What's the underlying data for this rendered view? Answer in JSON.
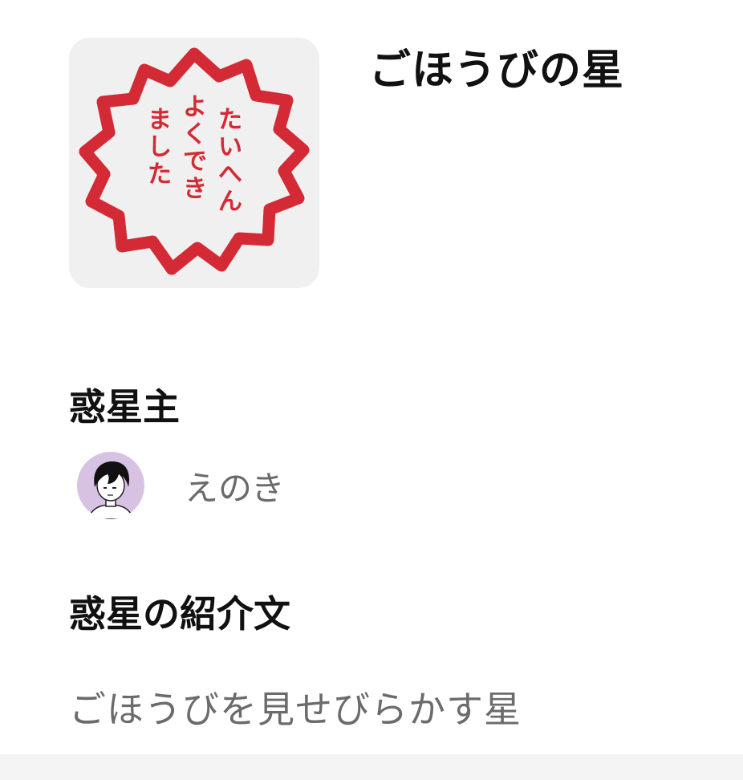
{
  "planet": {
    "name": "ごほうびの星",
    "icon_name": "praise-stamp-icon",
    "stamp_lines": [
      "たいへん",
      "よくでき",
      "ました"
    ],
    "stamp_color": "#d42a35"
  },
  "owner_section": {
    "title": "惑星主",
    "owner": {
      "avatar_icon": "user-avatar-icon",
      "avatar_bg": "#d8c2e4",
      "name": "えのき"
    }
  },
  "intro_section": {
    "title": "惑星の紹介文",
    "text": "ごほうびを見せびらかす星"
  }
}
